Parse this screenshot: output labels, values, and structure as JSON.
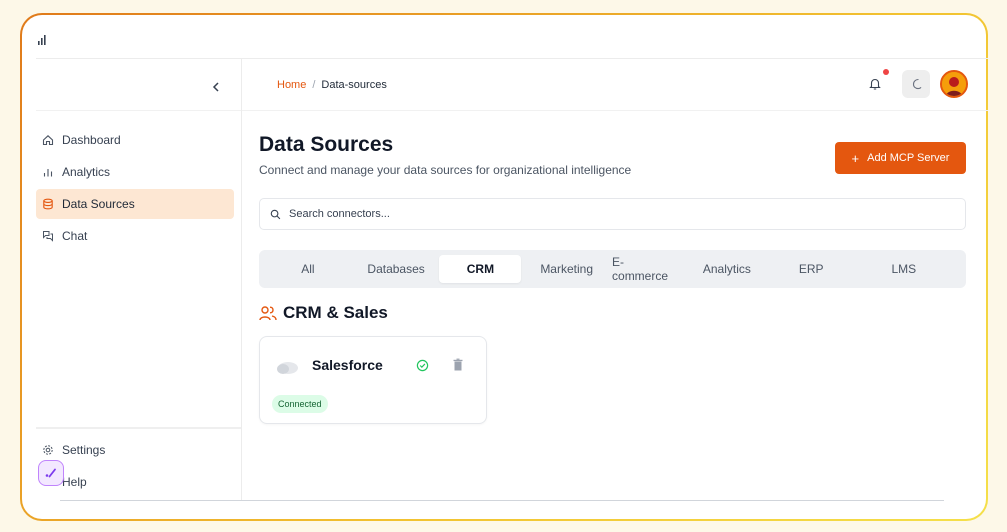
{
  "colors": {
    "accent": "#e4570f",
    "active_nav_bg": "#fde7d3",
    "connected_bg": "#dcfce7",
    "connected_text": "#166534",
    "notification_dot": "#ef4444"
  },
  "sidebar": {
    "collapse_icon": "chevron-left-icon",
    "items": [
      {
        "label": "Dashboard",
        "icon": "home-icon",
        "active": false
      },
      {
        "label": "Analytics",
        "icon": "bar-chart-icon",
        "active": false
      },
      {
        "label": "Data Sources",
        "icon": "database-icon",
        "active": true
      },
      {
        "label": "Chat",
        "icon": "chat-icon",
        "active": false
      }
    ],
    "bottom_items": [
      {
        "label": "Settings",
        "icon": "gear-icon"
      },
      {
        "label": "Help",
        "icon": "help-icon"
      }
    ]
  },
  "header": {
    "breadcrumb": {
      "home": "Home",
      "separator": "/",
      "current": "Data-sources"
    }
  },
  "main": {
    "title": "Data Sources",
    "subtitle": "Connect and manage your data sources for organizational intelligence",
    "add_button": {
      "icon": "+",
      "label": "Add MCP Server"
    },
    "search": {
      "placeholder": "Search connectors..."
    },
    "tabs": [
      {
        "label": "All",
        "active": false
      },
      {
        "label": "Databases",
        "active": false
      },
      {
        "label": "CRM",
        "active": true
      },
      {
        "label": "Marketing",
        "active": false
      },
      {
        "label": "E-commerce",
        "active": false
      },
      {
        "label": "Analytics",
        "active": false
      },
      {
        "label": "ERP",
        "active": false
      },
      {
        "label": "LMS",
        "active": false
      }
    ],
    "section": {
      "title": "CRM & Sales",
      "icon": "users-icon"
    },
    "connectors": [
      {
        "name": "Salesforce",
        "icon": "cloud-icon",
        "status": "Connected"
      }
    ]
  }
}
